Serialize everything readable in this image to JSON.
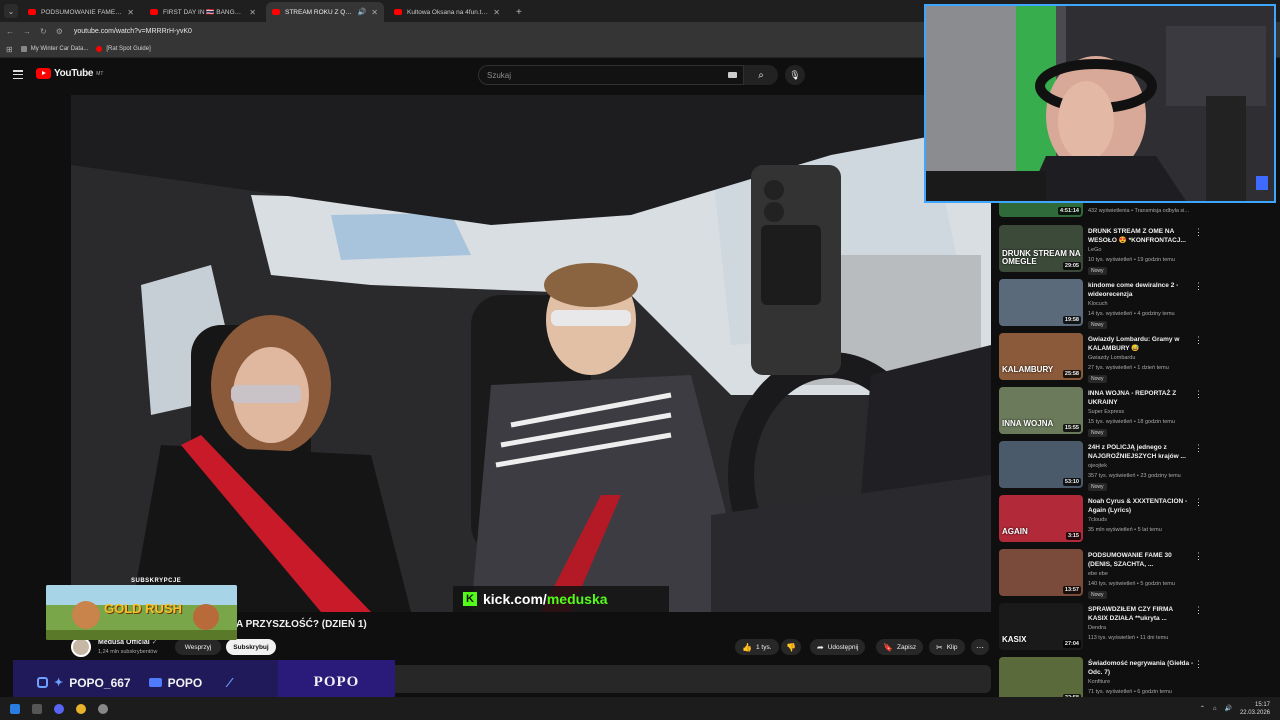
{
  "browser": {
    "tabs": [
      {
        "label": "PODSUMOWANIE FAME 30 (DE",
        "active": false,
        "audio": false
      },
      {
        "label": "FIRST DAY IN 🇹🇭 BANGKOK - Yo",
        "active": false,
        "audio": false
      },
      {
        "label": "STREAM ROKU Z QOQSIK",
        "active": true,
        "audio": true
      },
      {
        "label": "Kultowa Oksana na 4fun.tv - dy",
        "active": false,
        "audio": false
      }
    ],
    "new_tab_icon": "+",
    "url": "youtube.com/watch?v=MRRRrH-yvK0",
    "bookmarks": [
      "My Winter Car Data...",
      "[Rat Spot Guide]"
    ]
  },
  "youtube": {
    "logo": "YouTube",
    "region": "MT",
    "search_placeholder": "Szukaj",
    "video": {
      "title": "A PRZYSZŁOŚĆ? (DZIEŃ 1)",
      "overlay_text": "kick.com/",
      "overlay_slug": "meduska",
      "channel": "Medusa Official",
      "subscribers": "1,24 mln subskrybentów",
      "support_label": "Wesprzyj",
      "subscribe_label": "Subskrybuj",
      "likes": "1 tys.",
      "share_label": "Udostępnij",
      "save_label": "Zapisz",
      "clip_label": "Klip"
    },
    "recommendations": [
      {
        "title": "",
        "channel": "",
        "meta": "432 wyświetlenia • Transmisja odbyła si...",
        "duration": "4:51:14",
        "badge": "",
        "thumb_text": "",
        "color": "#2f6a3a"
      },
      {
        "title": "DRUNK STREAM Z OME NA WESOŁO 😍 *KONFRONTACJ...",
        "channel": "LeGo",
        "meta": "10 tys. wyświetleń • 19 godzin temu",
        "duration": "29:05",
        "badge": "Nowy",
        "thumb_text": "DRUNK STREAM NA OMEGLE",
        "color": "#3c4a3a"
      },
      {
        "title": "kindome come dewiralnce 2 - wideorecenzja",
        "channel": "Klocuch",
        "meta": "14 tys. wyświetleń • 4 godziny temu",
        "duration": "19:58",
        "badge": "Nowy",
        "thumb_text": "",
        "color": "#5b6a7a"
      },
      {
        "title": "Gwiazdy Lombardu: Gramy w KALAMBURY 😅",
        "channel": "Gwiazdy Lombardu",
        "meta": "27 tys. wyświetleń • 1 dzień temu",
        "duration": "25:58",
        "badge": "Nowy",
        "thumb_text": "KALAMBURY",
        "color": "#8a5a3a"
      },
      {
        "title": "INNA WOJNA - REPORTAŻ Z UKRAINY",
        "channel": "Super Express",
        "meta": "15 tys. wyświetleń • 18 godzin temu",
        "duration": "15:55",
        "badge": "Nowy",
        "thumb_text": "INNA WOJNA",
        "color": "#6a7a5a"
      },
      {
        "title": "24H z POLICJĄ jednego z NAJGROŹNIEJSZYCH krajów ...",
        "channel": "ojeojtek",
        "meta": "357 tys. wyświetleń • 23 godziny temu",
        "duration": "53:10",
        "badge": "Nowy",
        "thumb_text": "",
        "color": "#4a5a6a"
      },
      {
        "title": "Noah Cyrus & XXXTENTACION - Again (Lyrics)",
        "channel": "7clouds",
        "meta": "35 mln wyświetleń • 5 lat temu",
        "duration": "3:15",
        "badge": "",
        "thumb_text": "AGAIN",
        "color": "#b22a3a"
      },
      {
        "title": "PODSUMOWANIE FAME 30 (DENIS, SZACHTA, ...",
        "channel": "ebe ebe",
        "meta": "140 tys. wyświetleń • 5 godzin temu",
        "duration": "13:57",
        "badge": "Nowy",
        "thumb_text": "",
        "color": "#7a4a3a"
      },
      {
        "title": "SPRAWDZIŁEM CZY FIRMA KASIX DZIAŁA **ukryta ...",
        "channel": "Dendra",
        "meta": "113 tys. wyświetleń • 11 dni temu",
        "duration": "27:04",
        "badge": "",
        "thumb_text": "KASIX",
        "color": "#1a1a1a"
      },
      {
        "title": "Świadomość negrywania (Giełda - Odc. 7)",
        "channel": "Konfiture",
        "meta": "71 tys. wyświetleń • 6 godzin temu",
        "duration": "22:58",
        "badge": "",
        "thumb_text": "",
        "color": "#5a6a3a"
      }
    ]
  },
  "overlays": {
    "subscriptions_label": "SUBSKRYPCJE",
    "game_label": "GOLD RUSH",
    "social_handle_1": "POPO_667",
    "social_handle_2": "POPO",
    "brand": "POPO"
  },
  "taskbar": {
    "time": "15:17",
    "date": "22.03.2026"
  }
}
